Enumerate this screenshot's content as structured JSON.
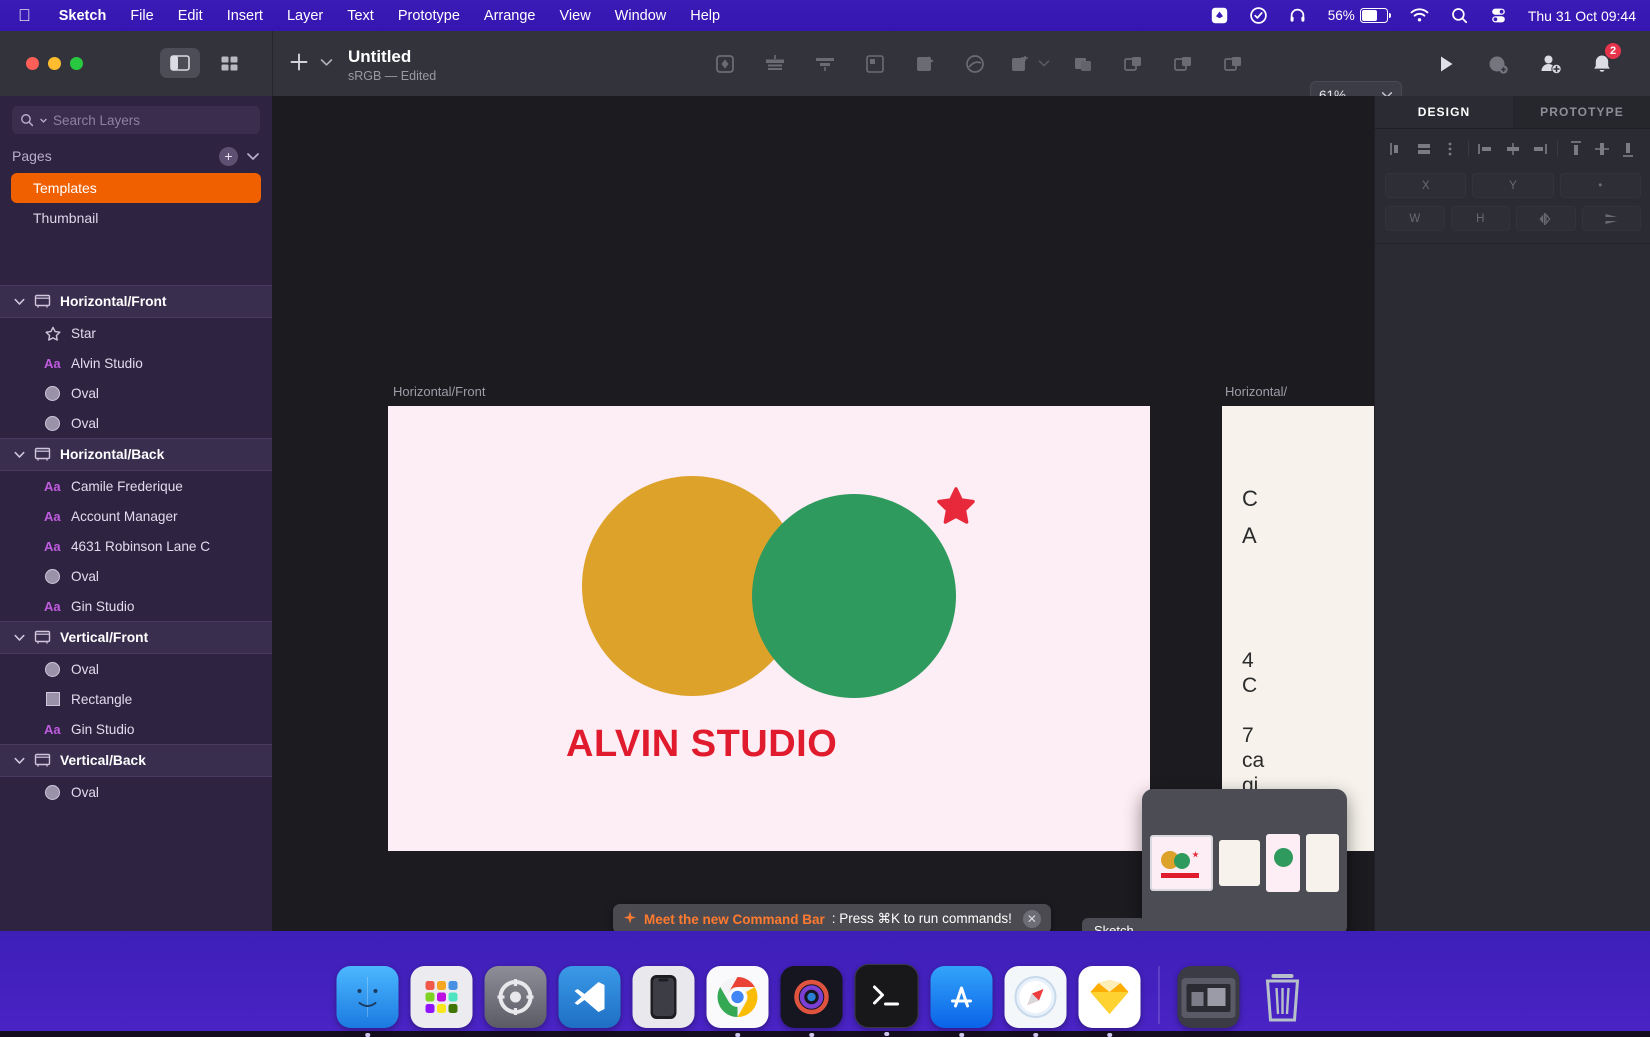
{
  "menubar": {
    "apple_icon": "apple-logo",
    "items": [
      "Sketch",
      "File",
      "Edit",
      "Insert",
      "Layer",
      "Text",
      "Prototype",
      "Arrange",
      "View",
      "Window",
      "Help"
    ],
    "tray": {
      "dropbox_icon": "dropbox-icon",
      "checkmark_icon": "checkmark-circle-icon",
      "headphones_icon": "headphones-icon",
      "battery_percent": "56%",
      "wifi_icon": "wifi-icon",
      "search_icon": "spotlight-search-icon",
      "control_center_icon": "control-center-icon",
      "clock": "Thu 31 Oct  09:44"
    }
  },
  "toolbar": {
    "doc_title": "Untitled",
    "doc_subtitle": "sRGB — Edited",
    "plus_icon": "add-icon",
    "chevron_icon": "chevron-down-icon",
    "zoom_level": "61%",
    "icons": [
      "mask-icon",
      "align-distribute-icon",
      "align-vertical-icon",
      "component-icon",
      "smart-layout-icon",
      "cloud-icon",
      "artboard-icon",
      "union-icon",
      "subtract-icon",
      "intersect-icon",
      "difference-icon"
    ],
    "play_icon": "preview-play-icon",
    "insert_icon": "insert-component-icon",
    "share_icon": "add-collaborator-icon",
    "bell_icon": "notifications-bell-icon",
    "bell_badge": "2"
  },
  "sidebar": {
    "search_placeholder": "Search Layers",
    "pages_label": "Pages",
    "add_page_icon": "add-page-icon",
    "collapse_icon": "chevron-down-icon",
    "pages": [
      {
        "label": "Templates",
        "selected": true
      },
      {
        "label": "Thumbnail",
        "selected": false
      }
    ],
    "groups": [
      {
        "name": "Horizontal/Front",
        "layers": [
          {
            "label": "Star",
            "icon": "star-shape-icon"
          },
          {
            "label": "Alvin Studio",
            "icon": "text-layer-icon"
          },
          {
            "label": "Oval",
            "icon": "oval-shape-icon"
          },
          {
            "label": "Oval",
            "icon": "oval-shape-icon"
          }
        ]
      },
      {
        "name": "Horizontal/Back",
        "layers": [
          {
            "label": "Camile Frederique",
            "icon": "text-layer-icon"
          },
          {
            "label": "Account Manager",
            "icon": "text-layer-icon"
          },
          {
            "label": "4631 Robinson Lane C",
            "icon": "text-layer-icon"
          },
          {
            "label": "Oval",
            "icon": "oval-shape-icon"
          },
          {
            "label": "Gin Studio",
            "icon": "text-layer-icon"
          }
        ]
      },
      {
        "name": "Vertical/Front",
        "layers": [
          {
            "label": "Oval",
            "icon": "oval-shape-icon"
          },
          {
            "label": "Rectangle",
            "icon": "rectangle-shape-icon"
          },
          {
            "label": "Gin Studio",
            "icon": "text-layer-icon"
          }
        ]
      },
      {
        "name": "Vertical/Back",
        "layers": [
          {
            "label": "Oval",
            "icon": "oval-shape-icon"
          }
        ]
      }
    ]
  },
  "canvas": {
    "artboard1": {
      "label": "Horizontal/Front",
      "title": "ALVIN STUDIO",
      "background": "#fdedf4",
      "shapes": [
        {
          "name": "oval-yellow",
          "color": "#dda22a"
        },
        {
          "name": "oval-green",
          "color": "#2f9a5e"
        },
        {
          "name": "star-red",
          "color": "#e8293b"
        }
      ]
    },
    "artboard2": {
      "label": "Horizontal/",
      "background": "#f7f3ec",
      "lines": [
        "C",
        "A",
        "4",
        "C",
        "7",
        "ca",
        "gi"
      ]
    }
  },
  "toast": {
    "sparkle_icon": "sparkle-icon",
    "highlight": "Meet the new Command Bar",
    "message": ": Press ⌘K to run commands!",
    "close_icon": "close-icon"
  },
  "inspector": {
    "tabs": [
      {
        "label": "DESIGN",
        "active": true
      },
      {
        "label": "PROTOTYPE",
        "active": false
      }
    ],
    "align_icons": [
      "align-left-icon",
      "align-center-horizontal-icon",
      "distribute-horizontal-icon",
      "align-left-edge-icon",
      "align-center-icon",
      "align-right-edge-icon",
      "align-top-icon",
      "align-middle-icon",
      "align-bottom-icon"
    ],
    "fields_row1": [
      "X",
      "Y",
      "•"
    ],
    "fields_row2": [
      "W",
      "H",
      "flip-horizontal-icon",
      "flip-vertical-icon"
    ]
  },
  "dock": {
    "items": [
      {
        "name": "finder",
        "color": "#2a9df4",
        "running": true
      },
      {
        "name": "launchpad",
        "color": "#6e6e7a",
        "running": false
      },
      {
        "name": "system-settings",
        "color": "#6b6b74",
        "running": false
      },
      {
        "name": "visual-studio-code",
        "color": "#2a7fd4",
        "running": false
      },
      {
        "name": "iphone-mirroring",
        "color": "#e8e8ea",
        "running": false
      },
      {
        "name": "google-chrome",
        "color": "#f1f1f3",
        "running": true
      },
      {
        "name": "orbit-app",
        "color": "#1c1c22",
        "running": true
      },
      {
        "name": "terminal",
        "color": "#1c1c1c",
        "running": true
      },
      {
        "name": "app-store",
        "color": "#1b7ef5",
        "running": true
      },
      {
        "name": "safari",
        "color": "#f2f5f8",
        "running": true
      },
      {
        "name": "sketch",
        "color": "#fdad00",
        "running": true
      },
      {
        "name": "downloads-folder",
        "color": "#3a3a44",
        "running": false
      },
      {
        "name": "trash",
        "color": "#9aa6ae",
        "running": false
      }
    ],
    "tooltip": "Sketch"
  }
}
